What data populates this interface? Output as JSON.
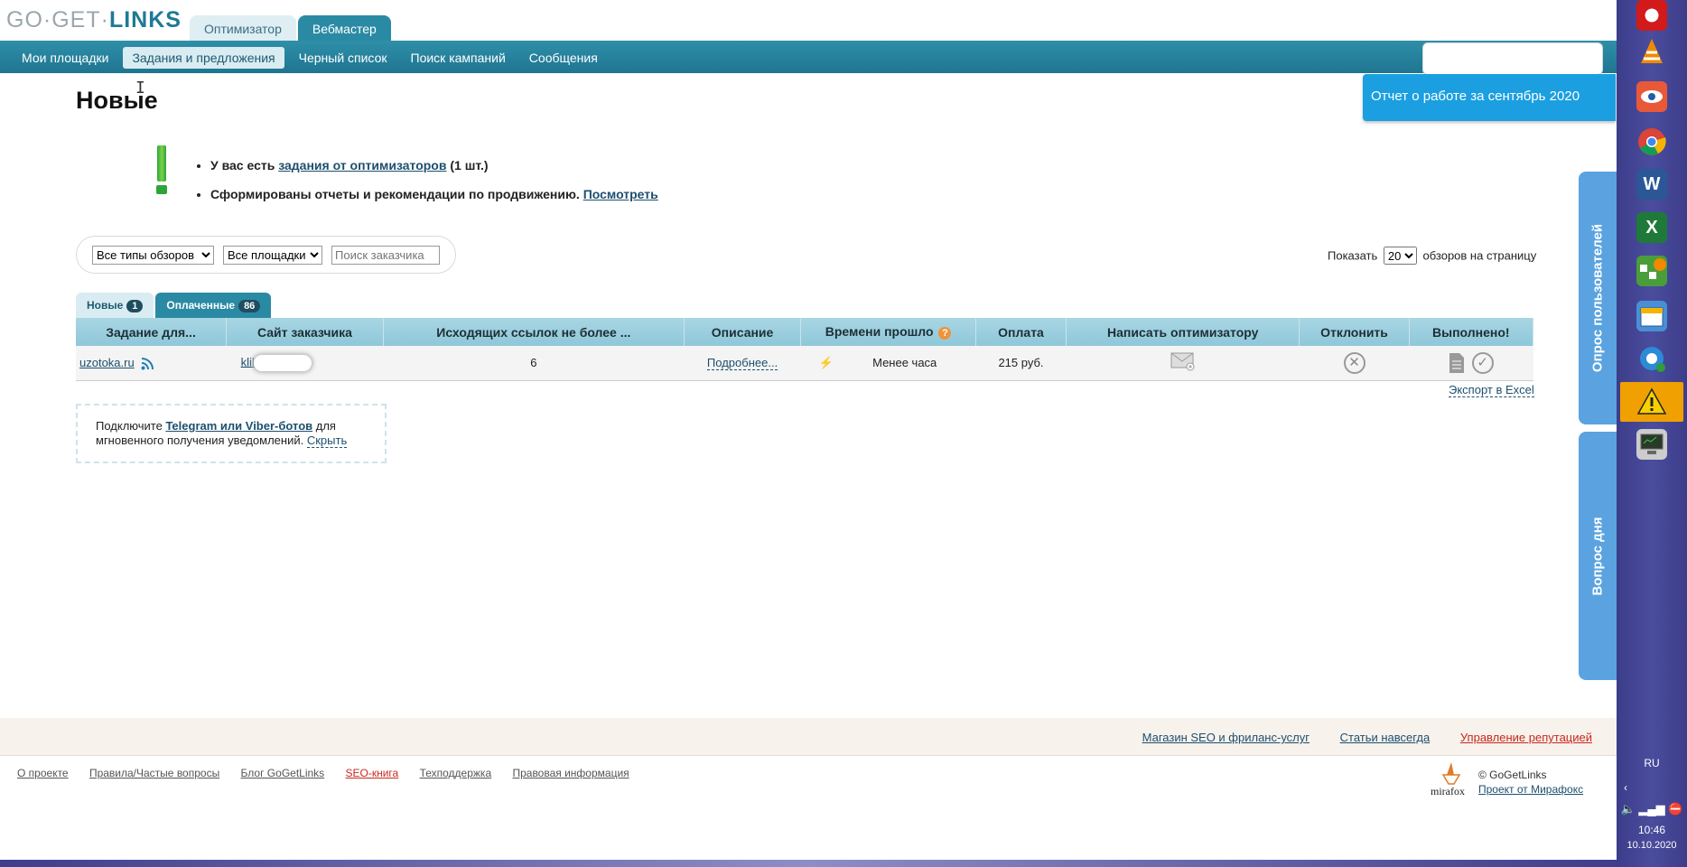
{
  "logo": {
    "go": "GO",
    "get": "GET",
    "links": "LINKS"
  },
  "top_tabs": [
    "Оптимизатор",
    "Вебмастер"
  ],
  "nav": [
    "Мои площадки",
    "Задания и предложения",
    "Черный список",
    "Поиск кампаний",
    "Сообщения"
  ],
  "report_button": "Отчет о работе за сентябрь 2020",
  "page_title": "Новые",
  "notices": {
    "first_prefix": "У вас есть ",
    "first_link": "задания от оптимизаторов",
    "first_suffix": " (1 шт.)",
    "second_text": "Сформированы отчеты и рекомендации по продвижению. ",
    "second_link": "Посмотреть"
  },
  "filters": {
    "review_type": "Все типы обзоров",
    "sites": "Все площадки",
    "search_placeholder": "Поиск заказчика"
  },
  "pagination": {
    "show": "Показать",
    "per_page": "20",
    "suffix": "обзоров на страницу"
  },
  "tabs": [
    {
      "label": "Новые",
      "count": "1"
    },
    {
      "label": "Оплаченные",
      "count": "86"
    }
  ],
  "table": {
    "headers": [
      "Задание для...",
      "Сайт заказчика",
      "Исходящих ссылок не более ...",
      "Описание",
      "Времени прошло",
      "Оплата",
      "Написать оптимизатору",
      "Отклонить",
      "Выполнено!"
    ],
    "row": {
      "task_for": "uzotoka.ru",
      "customer_site": "klik",
      "outgoing_links": "6",
      "description": "Подробнее...",
      "time_passed": "Менее часа",
      "payment": "215 руб."
    }
  },
  "export_excel": "Экспорт в Excel",
  "telegram": {
    "prefix": "Подключите ",
    "link": "Telegram или Viber-ботов",
    "suffix": " для мгновенного получения уведомлений. ",
    "hide": "Скрыть"
  },
  "side_tabs": [
    "Опрос пользователей",
    "Вопрос дня"
  ],
  "footer": {
    "top_links": [
      "Магазин SEO и фриланс-услуг",
      "Статьи навсегда",
      "Управление репутацией"
    ],
    "links": [
      "О проекте",
      "Правила/Частые вопросы",
      "Блог GoGetLinks",
      "SEO-книга",
      "Техподдержка",
      "Правовая информация"
    ],
    "copyright": "© GoGetLinks",
    "project_link": "Проект от Мирафокс",
    "mirafox_logo": "mirafox"
  },
  "taskbar": {
    "lang": "RU",
    "time": "10:46",
    "date": "10.10.2020"
  },
  "colors": {
    "nav": "#1f7591",
    "report": "#1b9fe0",
    "side_tab": "#5aa3e0",
    "taskbar": "#3c3d8a"
  }
}
